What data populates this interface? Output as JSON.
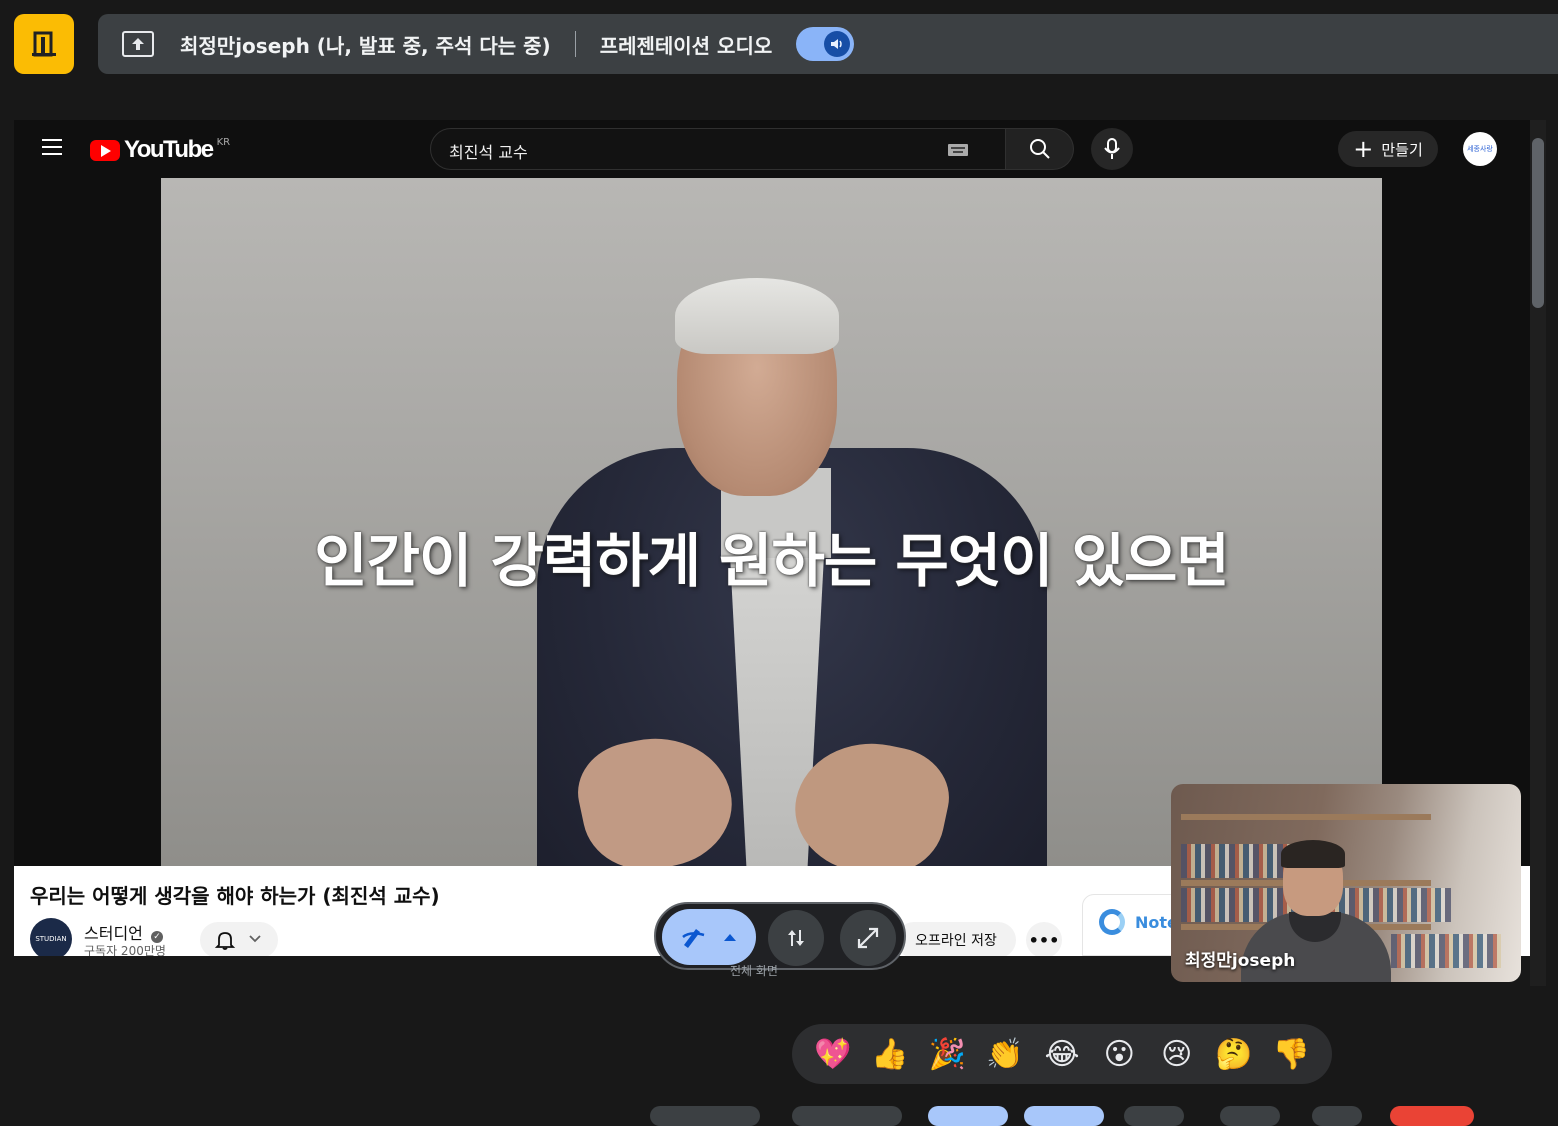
{
  "meet": {
    "presenter_status": "최정만joseph (나, 발표 중, 주석 다는 중)",
    "audio_label": "프레젠테이션 오디오",
    "self_name": "최정만joseph"
  },
  "youtube": {
    "logo_text": "YouTube",
    "region": "KR",
    "search_value": "최진석 교수",
    "create_label": "만들기",
    "avatar_text": "세종사랑"
  },
  "video": {
    "caption": "인간이 강력하게 원하는 무엇이 있으면",
    "title": "우리는 어떻게 생각을 해야 하는가 (최진석 교수)",
    "channel_name": "스터디언",
    "channel_logo": "STUDIAN",
    "subscribers": "구독자 200만명",
    "offline_label": "오프라인 저장",
    "more_label": "•••",
    "note_label": "Note"
  },
  "annotation": {
    "subtext": "전체 화면"
  },
  "reactions": [
    "💖",
    "👍",
    "🎉",
    "👏",
    "😂",
    "😮",
    "😢",
    "🤔",
    "👎"
  ]
}
